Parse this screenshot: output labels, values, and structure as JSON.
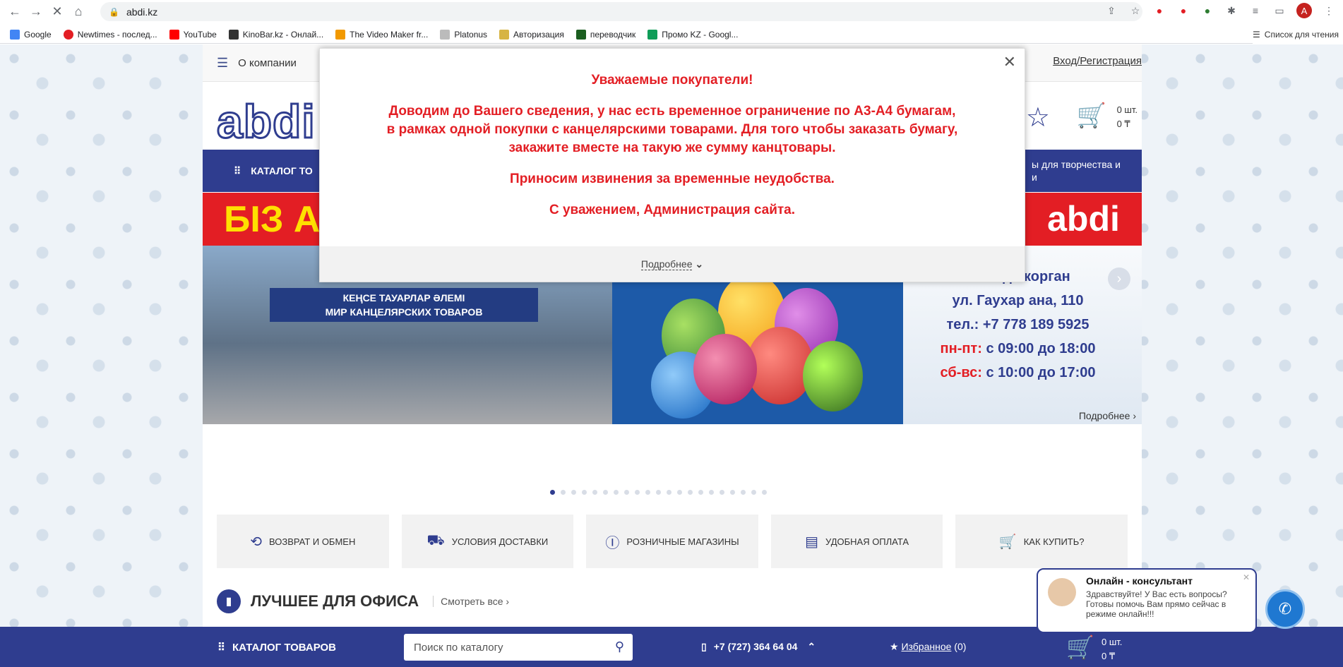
{
  "browser": {
    "url": "abdi.kz",
    "bookmarks": [
      "Google",
      "Newtimes - послед...",
      "YouTube",
      "KinoBar.kz - Онлай...",
      "The Video Maker fr...",
      "Platonus",
      "Авторизация",
      "переводчик",
      "Промо KZ - Googl..."
    ],
    "reading_list": "Список для чтения",
    "profile_initial": "A"
  },
  "site": {
    "about": "О компании",
    "login": "Вход/Регистрация",
    "logo": "abdi",
    "favorites_count": "0",
    "cart_qty": "0 шт.",
    "cart_sum": "0 ₸",
    "catalog": "КАТАЛОГ ТО",
    "catalog_right": "ы для творчества и\nи"
  },
  "banner": {
    "big_text": "БІЗ А",
    "shop_sign_1": "КЕҢСЕ ТАУАРЛАР ӘЛЕМІ",
    "shop_sign_2": "МИР КАНЦЕЛЯРСКИХ ТОВАРОВ",
    "logo": "abdi",
    "city": "г. Талдыкорган",
    "street": "ул. Гаухар ана, 110",
    "phone": "тел.: +7 778 189 5925",
    "weekday_label": "пн-пт:",
    "weekday_hours": "с 09:00 до 18:00",
    "weekend_label": "сб-вс:",
    "weekend_hours": "с 10:00 до 17:00",
    "more": "Подробнее"
  },
  "features": [
    {
      "label": "Возврат и обмен",
      "icon": "return-icon"
    },
    {
      "label": "Условия доставки",
      "icon": "delivery-icon"
    },
    {
      "label": "Розничные магазины",
      "icon": "info-icon"
    },
    {
      "label": "Удобная оплата",
      "icon": "payment-icon"
    },
    {
      "label": "Как купить?",
      "icon": "cart-icon"
    }
  ],
  "section": {
    "title": "ЛУЧШЕЕ ДЛЯ ОФИСА",
    "link": "Смотреть все"
  },
  "modal": {
    "line1": "Уважаемые покупатели!",
    "line2": "Доводим до Вашего сведения, у нас есть временное ограничение по А3-А4 бумагам, в рамках одной покупки с канцелярскими товарами. Для того чтобы заказать бумагу, закажите вместе на такую же сумму канцтовары.",
    "line3": "Приносим извинения за временные неудобства.",
    "line4": "С уважением, Администрация сайта.",
    "more": "Подробнее"
  },
  "bottom": {
    "catalog": "КАТАЛОГ ТОВАРОВ",
    "search_placeholder": "Поиск по каталогу",
    "phone": "+7 (727) 364 64 04",
    "favorites_label": "Избранное",
    "favorites_count": "(0)",
    "cart_qty": "0 шт.",
    "cart_sum": "0 ₸"
  },
  "chat": {
    "title": "Онлайн - консультант",
    "text": "Здравствуйте! У Вас есть вопросы? Готовы помочь Вам прямо сейчас в режиме онлайн!!!"
  }
}
